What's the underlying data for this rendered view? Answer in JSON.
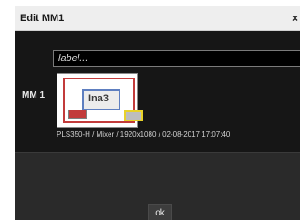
{
  "dialog": {
    "title": "Edit MM1",
    "close_glyph": "×"
  },
  "form": {
    "label_placeholder": "label...",
    "row_label": "MM 1",
    "thumbnail_text": "Ina3",
    "info_line": "PLS350-H / Mixer / 1920x1080 / 02-08-2017 17:07:40"
  },
  "footer": {
    "ok_label": "ok"
  },
  "colors": {
    "title_bg": "#eeeeee",
    "body_bg": "#161616",
    "thumb_red": "#c23b3b",
    "thumb_blue": "#5e7fc0",
    "thumb_yellow": "#e8d22a"
  }
}
